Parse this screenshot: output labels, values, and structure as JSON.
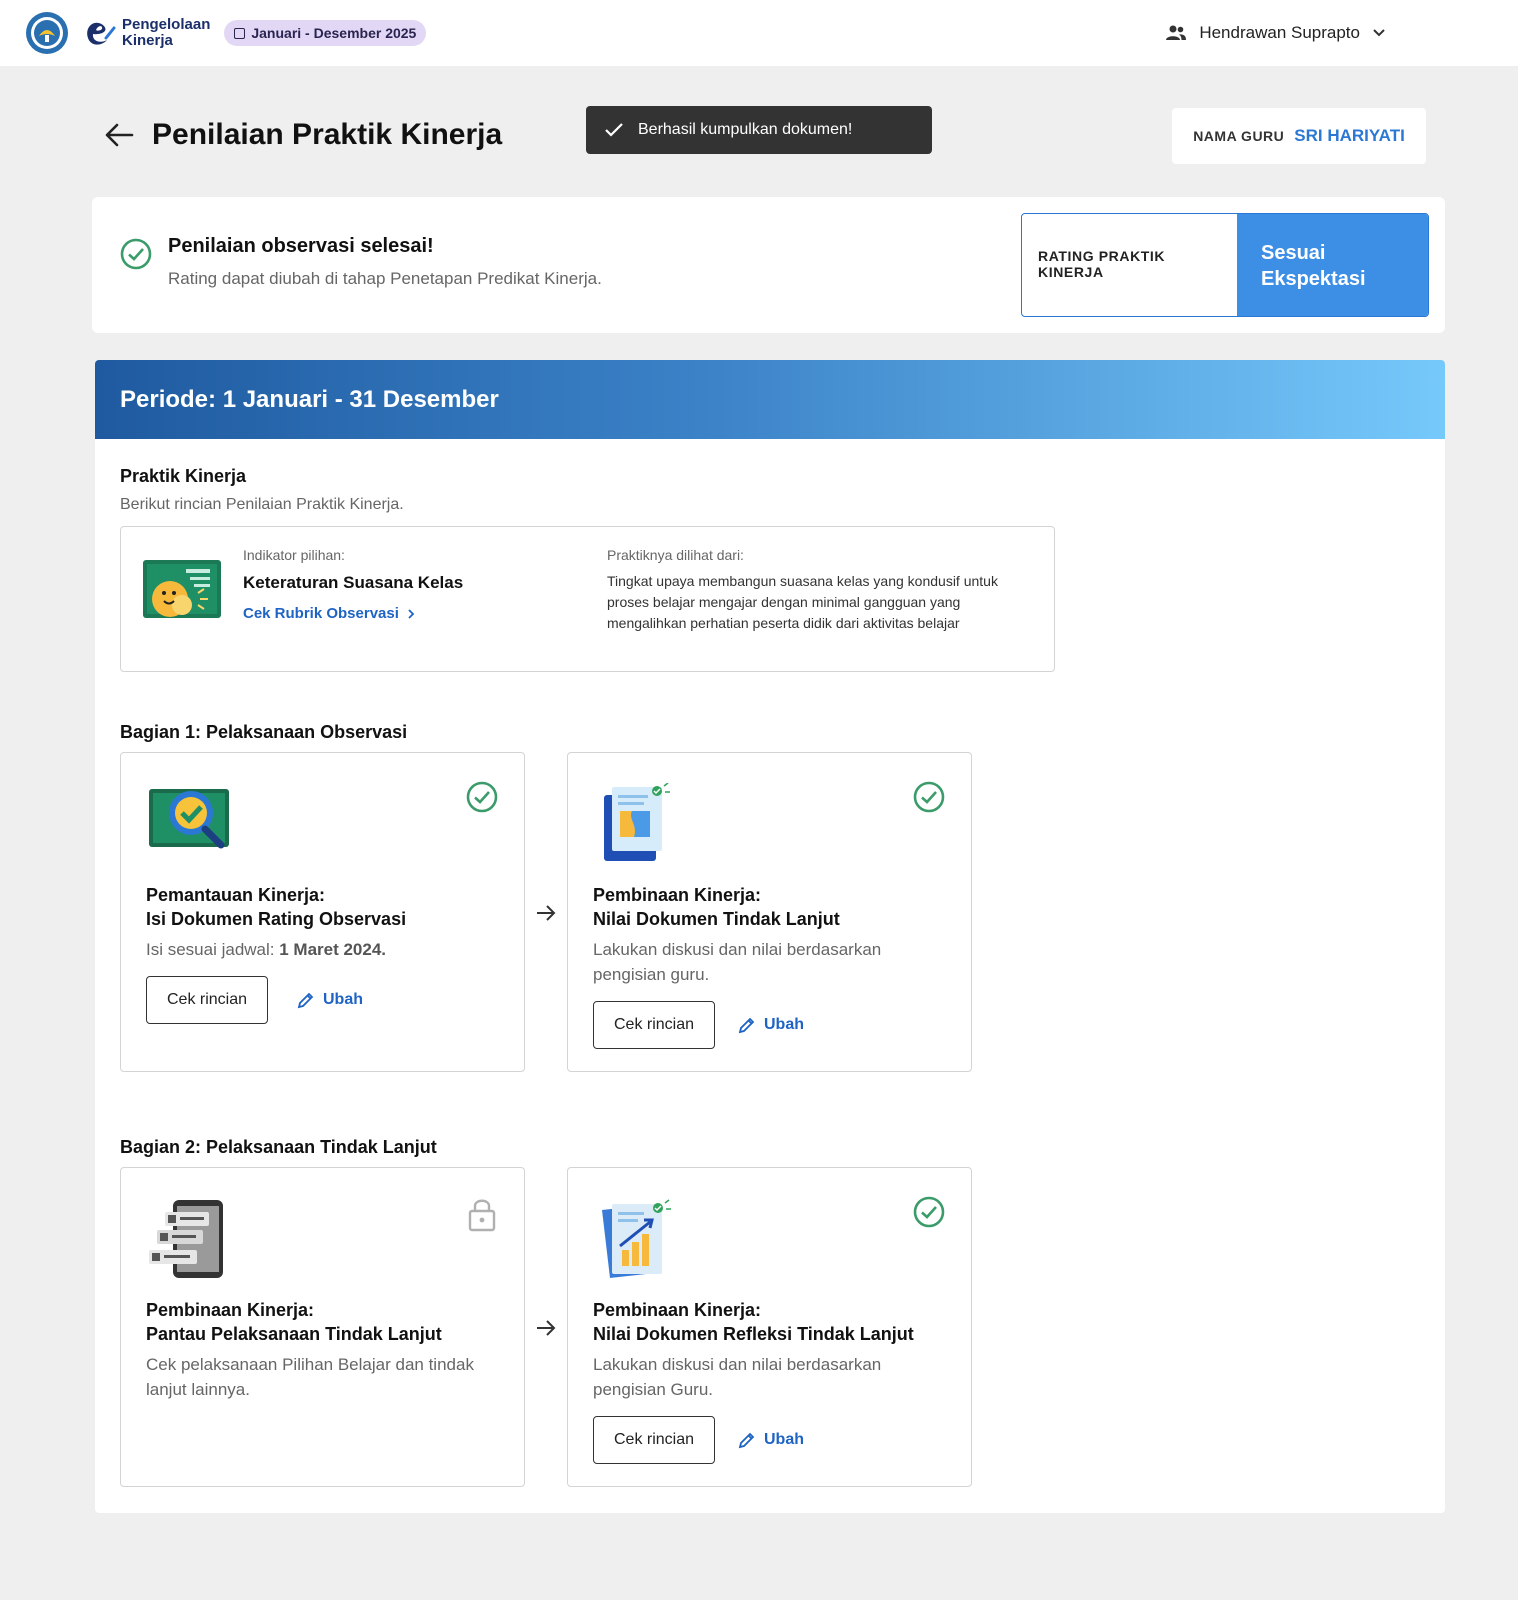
{
  "topbar": {
    "app_name_line1": "Pengelolaan",
    "app_name_line2": "Kinerja",
    "period_chip": "Januari - Desember 2025",
    "user_name": "Hendrawan Suprapto"
  },
  "header": {
    "title": "Penilaian Praktik Kinerja",
    "toast": "Berhasil kumpulkan dokumen!",
    "teacher_label": "NAMA GURU",
    "teacher_name": "SRI HARIYATI"
  },
  "status": {
    "title": "Penilaian observasi selesai!",
    "subtitle": "Rating dapat diubah di tahap Penetapan Predikat Kinerja.",
    "rating_label": "RATING PRAKTIK KINERJA",
    "rating_value": "Sesuai Ekspektasi"
  },
  "main": {
    "period": "Periode: 1 Januari - 31 Desember",
    "practice_title": "Praktik Kinerja",
    "practice_sub": "Berikut rincian Penilaian Praktik Kinerja.",
    "indicator": {
      "label": "Indikator pilihan:",
      "name": "Keteraturan Suasana Kelas",
      "link": "Cek Rubrik Observasi",
      "seen_label": "Praktiknya dilihat dari:",
      "seen_text": "Tingkat upaya membangun suasana kelas yang kondusif untuk proses belajar mengajar dengan minimal gangguan yang mengalihkan perhatian peserta didik dari aktivitas belajar"
    },
    "part1": {
      "title": "Bagian 1: Pelaksanaan Observasi",
      "steps": [
        {
          "title_line1": "Pemantauan Kinerja:",
          "title_line2": "Isi Dokumen Rating Observasi",
          "desc_prefix": "Isi sesuai jadwal: ",
          "desc_bold": "1 Maret 2024.",
          "btn": "Cek rincian",
          "edit": "Ubah",
          "status_icon": "check-circle-icon"
        },
        {
          "title_line1": "Pembinaan Kinerja:",
          "title_line2": "Nilai Dokumen Tindak Lanjut",
          "desc": "Lakukan diskusi dan nilai berdasarkan pengisian guru.",
          "btn": "Cek rincian",
          "edit": "Ubah",
          "status_icon": "check-circle-icon"
        }
      ]
    },
    "part2": {
      "title": "Bagian 2: Pelaksanaan Tindak Lanjut",
      "steps": [
        {
          "title_line1": "Pembinaan Kinerja:",
          "title_line2": "Pantau Pelaksanaan Tindak Lanjut",
          "desc": "Cek pelaksanaan Pilihan Belajar dan tindak lanjut lainnya.",
          "status_icon": "lock-icon"
        },
        {
          "title_line1": "Pembinaan Kinerja:",
          "title_line2": "Nilai Dokumen Refleksi Tindak Lanjut",
          "desc": "Lakukan diskusi dan nilai berdasarkan pengisian Guru.",
          "btn": "Cek rincian",
          "edit": "Ubah",
          "status_icon": "check-circle-icon"
        }
      ]
    }
  },
  "colors": {
    "accent": "#2b78d4",
    "rating_bg": "#3d8fe6",
    "success": "#3b9b6a",
    "chip_bg": "#e2d8f5",
    "toast_bg": "#333333"
  }
}
